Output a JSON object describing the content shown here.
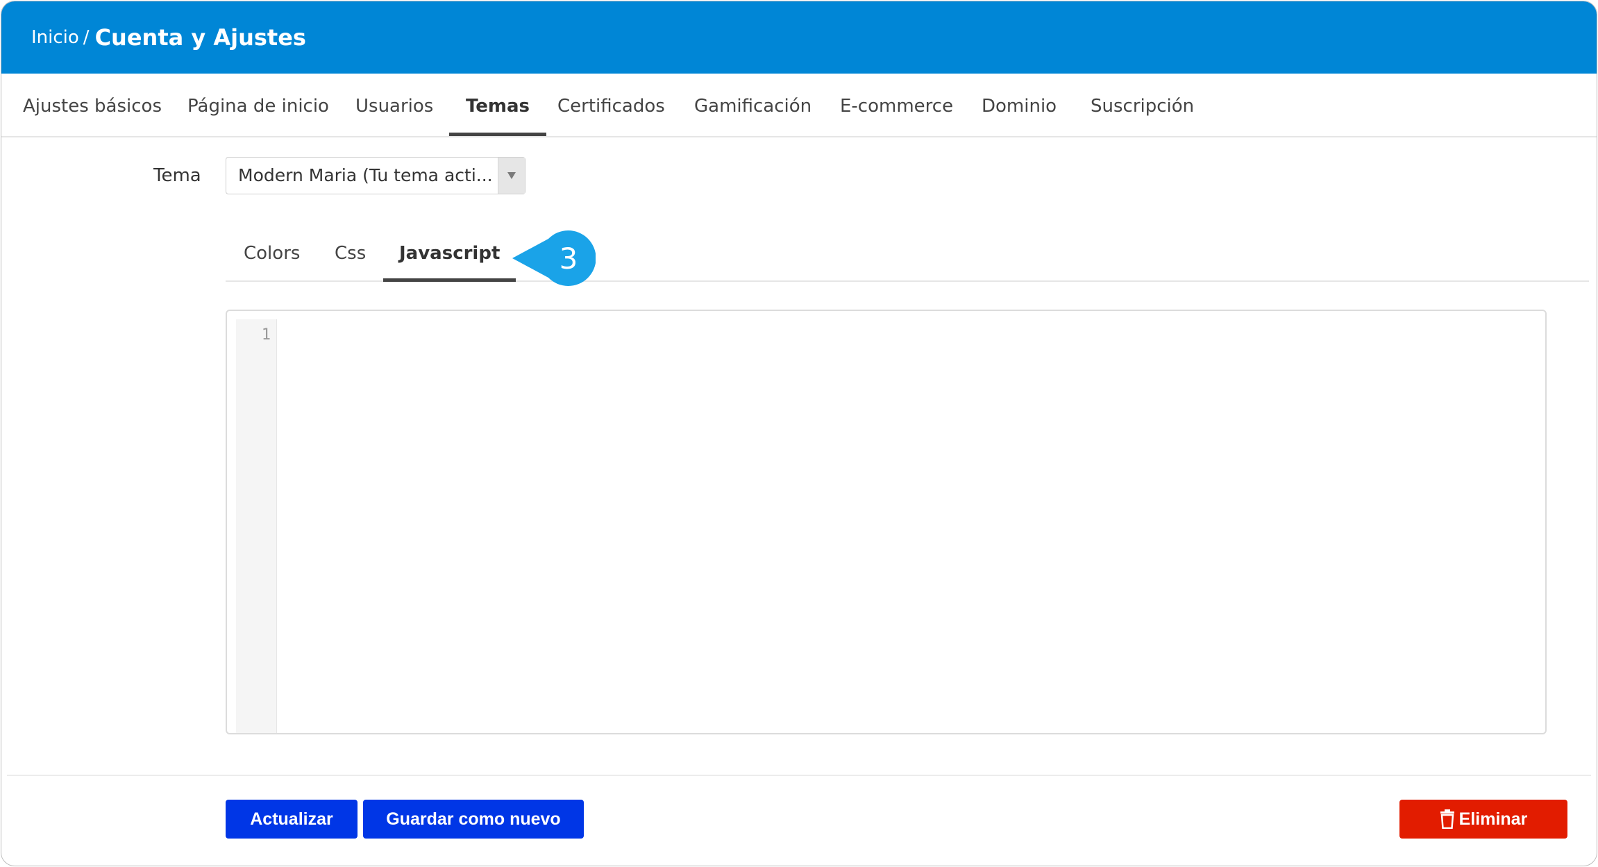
{
  "header": {
    "breadcrumb_home": "Inicio",
    "breadcrumb_separator": "/",
    "breadcrumb_current": "Cuenta y Ajustes"
  },
  "tabs": [
    {
      "label": "Ajustes básicos"
    },
    {
      "label": "Página de inicio"
    },
    {
      "label": "Usuarios"
    },
    {
      "label": "Temas"
    },
    {
      "label": "Certificados"
    },
    {
      "label": "Gamificación"
    },
    {
      "label": "E-commerce"
    },
    {
      "label": "Dominio"
    },
    {
      "label": "Suscripción"
    }
  ],
  "active_tab": "Temas",
  "theme": {
    "label": "Tema",
    "selected": "Modern Maria (Tu tema acti..."
  },
  "subtabs": [
    {
      "label": "Colors"
    },
    {
      "label": "Css"
    },
    {
      "label": "Javascript"
    }
  ],
  "active_subtab": "Javascript",
  "callout": {
    "number": "3"
  },
  "editor": {
    "line_numbers": [
      "1"
    ],
    "content": ""
  },
  "buttons": {
    "update": "Actualizar",
    "save_new": "Guardar como nuevo",
    "delete": "Eliminar"
  },
  "colors": {
    "header": "#0086d6",
    "primary_button": "#0036e6",
    "danger_button": "#e21c00",
    "callout": "#1aa3e8"
  },
  "icons": {
    "select_arrow": "triangle-down-icon",
    "delete": "trash-icon"
  }
}
